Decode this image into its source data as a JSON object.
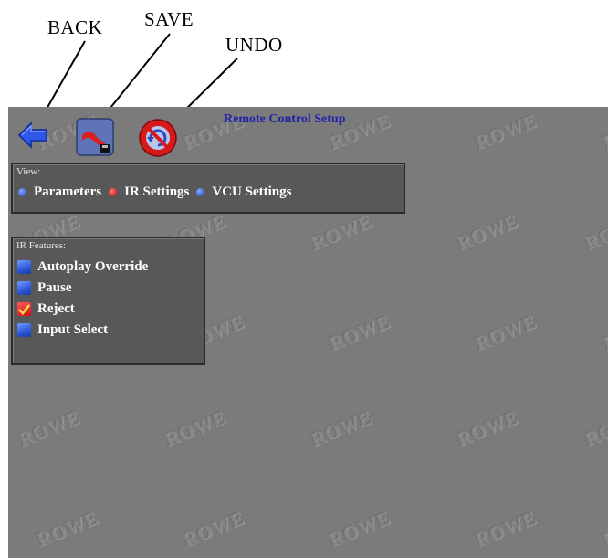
{
  "callouts": {
    "back": "BACK",
    "save": "SAVE",
    "undo": "UNDO"
  },
  "screen": {
    "title": "Remote Control Setup",
    "watermark": "ROWE",
    "toolbar": {
      "back_icon": "back-arrow-icon",
      "save_icon": "save-disk-icon",
      "undo_icon": "undo-icon"
    },
    "view_panel": {
      "title": "View:",
      "options": [
        {
          "label": "Parameters",
          "selected": false
        },
        {
          "label": "IR Settings",
          "selected": true
        },
        {
          "label": "VCU Settings",
          "selected": false
        }
      ]
    },
    "ir_panel": {
      "title": "IR Features:",
      "features": [
        {
          "label": "Autoplay Override",
          "checked": false
        },
        {
          "label": "Pause",
          "checked": false
        },
        {
          "label": "Reject",
          "checked": true
        },
        {
          "label": "Input Select",
          "checked": false
        }
      ]
    }
  },
  "colors": {
    "screen_bg": "#7b7b7b",
    "title_blue": "#2323a8",
    "radio_on": "#d00000",
    "radio_off": "#1f46c8"
  }
}
